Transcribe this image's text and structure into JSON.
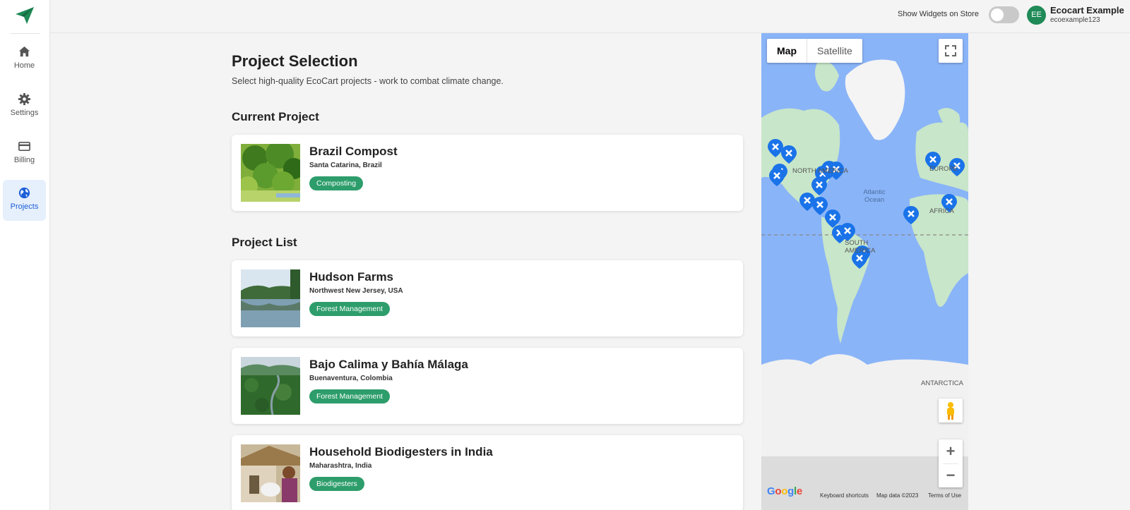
{
  "sidebar": {
    "logo_icon": "paper-plane-icon",
    "items": [
      {
        "label": "Home",
        "icon": "home-icon",
        "active": false
      },
      {
        "label": "Settings",
        "icon": "gear-icon",
        "active": false
      },
      {
        "label": "Billing",
        "icon": "credit-card-icon",
        "active": false
      },
      {
        "label": "Projects",
        "icon": "globe-icon",
        "active": true
      }
    ]
  },
  "header": {
    "widget_toggle_label": "Show Widgets on Store",
    "widget_toggle_on": false,
    "avatar_initials": "EE",
    "user_name": "Ecocart Example",
    "user_handle": "ecoexample123"
  },
  "page": {
    "title": "Project Selection",
    "subtitle": "Select high-quality EcoCart projects - work to combat climate change."
  },
  "current_project": {
    "heading": "Current Project",
    "name": "Brazil Compost",
    "location": "Santa Catarina, Brazil",
    "category": "Composting"
  },
  "project_list": {
    "heading": "Project List",
    "projects": [
      {
        "name": "Hudson Farms",
        "location": "Northwest New Jersey, USA",
        "category": "Forest Management"
      },
      {
        "name": "Bajo Calima y Bahía Málaga",
        "location": "Buenaventura, Colombia",
        "category": "Forest Management"
      },
      {
        "name": "Household Biodigesters in India",
        "location": "Maharashtra, India",
        "category": "Biodigesters"
      }
    ]
  },
  "map": {
    "type_options": [
      "Map",
      "Satellite"
    ],
    "selected_type": "Map",
    "labels": {
      "north_america": "NORTH AMERICA",
      "south_america": "SOUTH AMERICA",
      "europe": "EUROPE",
      "africa": "AFRICA",
      "atlantic": "Atlantic Ocean",
      "antarctica": "ANTARCTICA"
    },
    "google": "Google",
    "keyboard_shortcuts": "Keyboard shortcuts",
    "map_data": "Map data ©2023",
    "terms": "Terms of Use",
    "zoom_in": "+",
    "zoom_out": "−",
    "colors": {
      "water": "#8ab4f8",
      "land": "#c8e6c9",
      "ice": "#f1f1f1",
      "marker": "#1a73e8"
    }
  }
}
